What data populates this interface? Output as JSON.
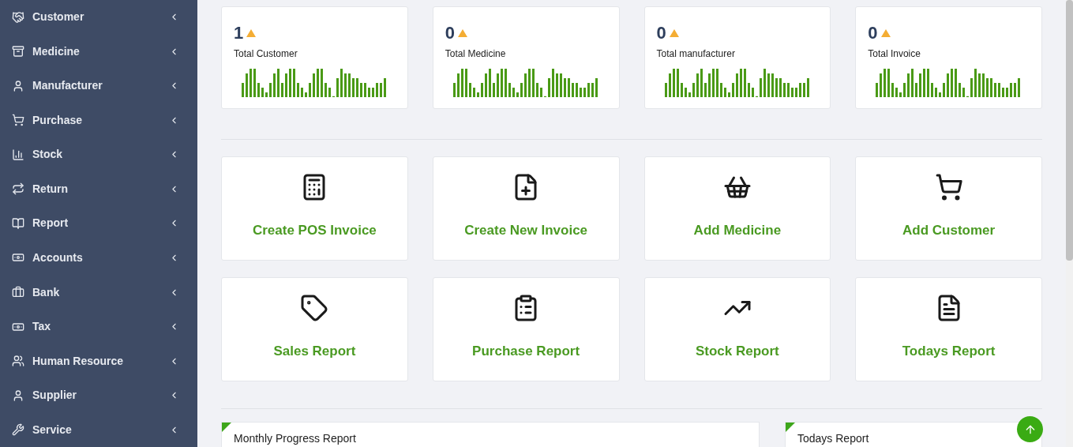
{
  "sidebar": {
    "items": [
      {
        "label": "Customer"
      },
      {
        "label": "Medicine"
      },
      {
        "label": "Manufacturer"
      },
      {
        "label": "Purchase"
      },
      {
        "label": "Stock"
      },
      {
        "label": "Return"
      },
      {
        "label": "Report"
      },
      {
        "label": "Accounts"
      },
      {
        "label": "Bank"
      },
      {
        "label": "Tax"
      },
      {
        "label": "Human Resource"
      },
      {
        "label": "Supplier"
      },
      {
        "label": "Service"
      }
    ]
  },
  "stats": [
    {
      "value": "1",
      "label": "Total Customer"
    },
    {
      "value": "0",
      "label": "Total Medicine"
    },
    {
      "value": "0",
      "label": "Total manufacturer"
    },
    {
      "value": "0",
      "label": "Total Invoice"
    }
  ],
  "shortcuts": [
    {
      "label": "Create POS Invoice"
    },
    {
      "label": "Create New Invoice"
    },
    {
      "label": "Add Medicine"
    },
    {
      "label": "Add Customer"
    },
    {
      "label": "Sales Report"
    },
    {
      "label": "Purchase Report"
    },
    {
      "label": "Stock Report"
    },
    {
      "label": "Todays Report"
    }
  ],
  "panels": [
    {
      "title": "Monthly Progress Report"
    },
    {
      "title": "Todays Report"
    }
  ]
}
